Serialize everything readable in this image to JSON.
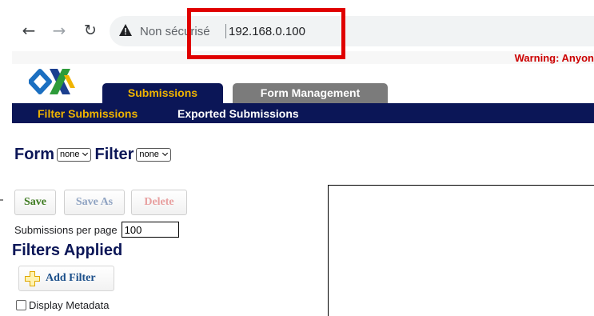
{
  "browser": {
    "security_label": "Non sécurisé",
    "url": "192.168.0.100"
  },
  "warning": {
    "text": "Warning: Anyon"
  },
  "tabs": [
    {
      "label": "Submissions",
      "active": true
    },
    {
      "label": "Form Management",
      "active": false
    }
  ],
  "subnav": {
    "filter_label": "Filter Submissions",
    "exported_label": "Exported Submissions"
  },
  "form_selector": {
    "form_label": "Form",
    "form_value": "none",
    "filter_label": "Filter",
    "filter_value": "none"
  },
  "toolbar": {
    "save_label": "Save",
    "save_as_label": "Save As",
    "delete_label": "Delete"
  },
  "submissions_per_page": {
    "label": "Submissions per page",
    "value": "100"
  },
  "filters": {
    "heading": "Filters Applied",
    "add_label": "Add Filter"
  },
  "metadata": {
    "label": "Display Metadata",
    "checked": false
  },
  "colors": {
    "navy": "#0b1657",
    "gold": "#f0b400",
    "highlight": "#e00000",
    "warning": "#cc0000"
  },
  "icons": [
    "back-arrow-icon",
    "forward-arrow-icon",
    "reload-icon",
    "warning-triangle-icon",
    "odk-logo",
    "chevron-down-icon",
    "plus-icon"
  ]
}
